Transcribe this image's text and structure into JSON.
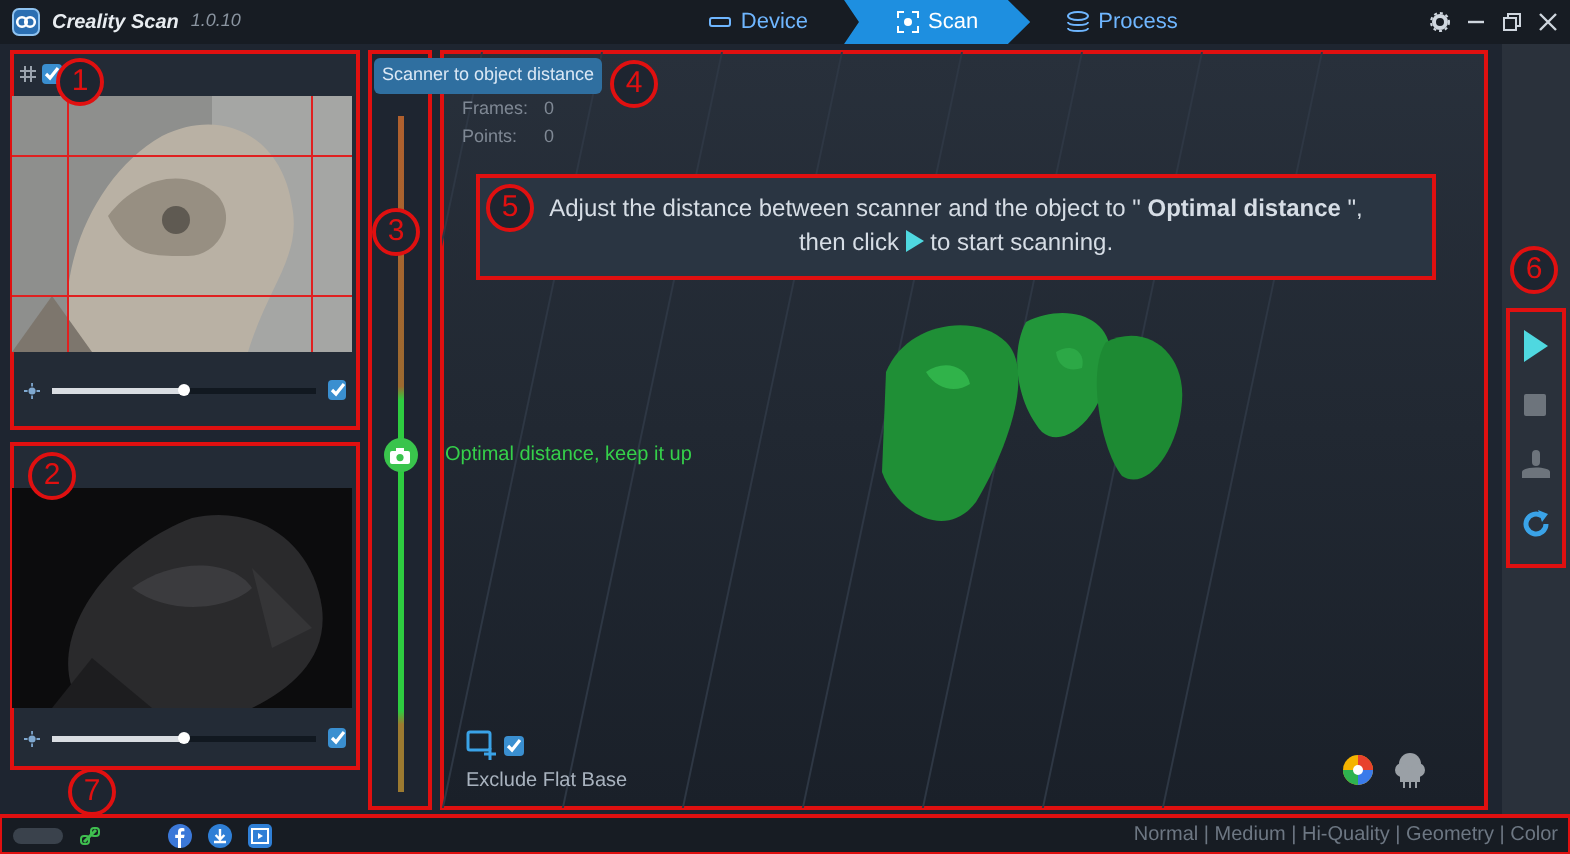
{
  "app": {
    "name": "Creality Scan",
    "version": "1.0.10"
  },
  "steps": [
    {
      "label": "Device",
      "selected": false
    },
    {
      "label": "Scan",
      "selected": true
    },
    {
      "label": "Process",
      "selected": false
    }
  ],
  "camera_panels": [
    {
      "annotation": "1",
      "kind": "texture",
      "grid_checked": true,
      "level": 0.5,
      "checked": true
    },
    {
      "annotation": "2",
      "kind": "depth",
      "level": 0.5,
      "checked": true
    }
  ],
  "distance": {
    "annotation": "3",
    "tooltip": "Scanner to object distance",
    "status": "Optimal distance, keep it up",
    "level": 0.5
  },
  "viewport": {
    "annotation": "4",
    "stats": [
      {
        "label": "Frames:",
        "value": "0"
      },
      {
        "label": "Points:",
        "value": "0"
      }
    ],
    "message": {
      "annotation": "5",
      "line1": "Adjust the distance between scanner and the object to \" **Optimal distance** \",",
      "line2_before": "then click",
      "line2_after": "to start scanning."
    },
    "exclude_flat_base": {
      "label": "Exclude Flat Base",
      "checked": true
    }
  },
  "toolbar": {
    "annotation": "6",
    "buttons": [
      {
        "kind": "play",
        "disabled": false
      },
      {
        "kind": "stop",
        "disabled": true
      },
      {
        "kind": "stamp",
        "disabled": true
      },
      {
        "kind": "refresh",
        "disabled": false
      }
    ]
  },
  "status_bar": {
    "annotation": "7",
    "modes": "Normal | Medium | Hi-Quality | Geometry | Color"
  }
}
